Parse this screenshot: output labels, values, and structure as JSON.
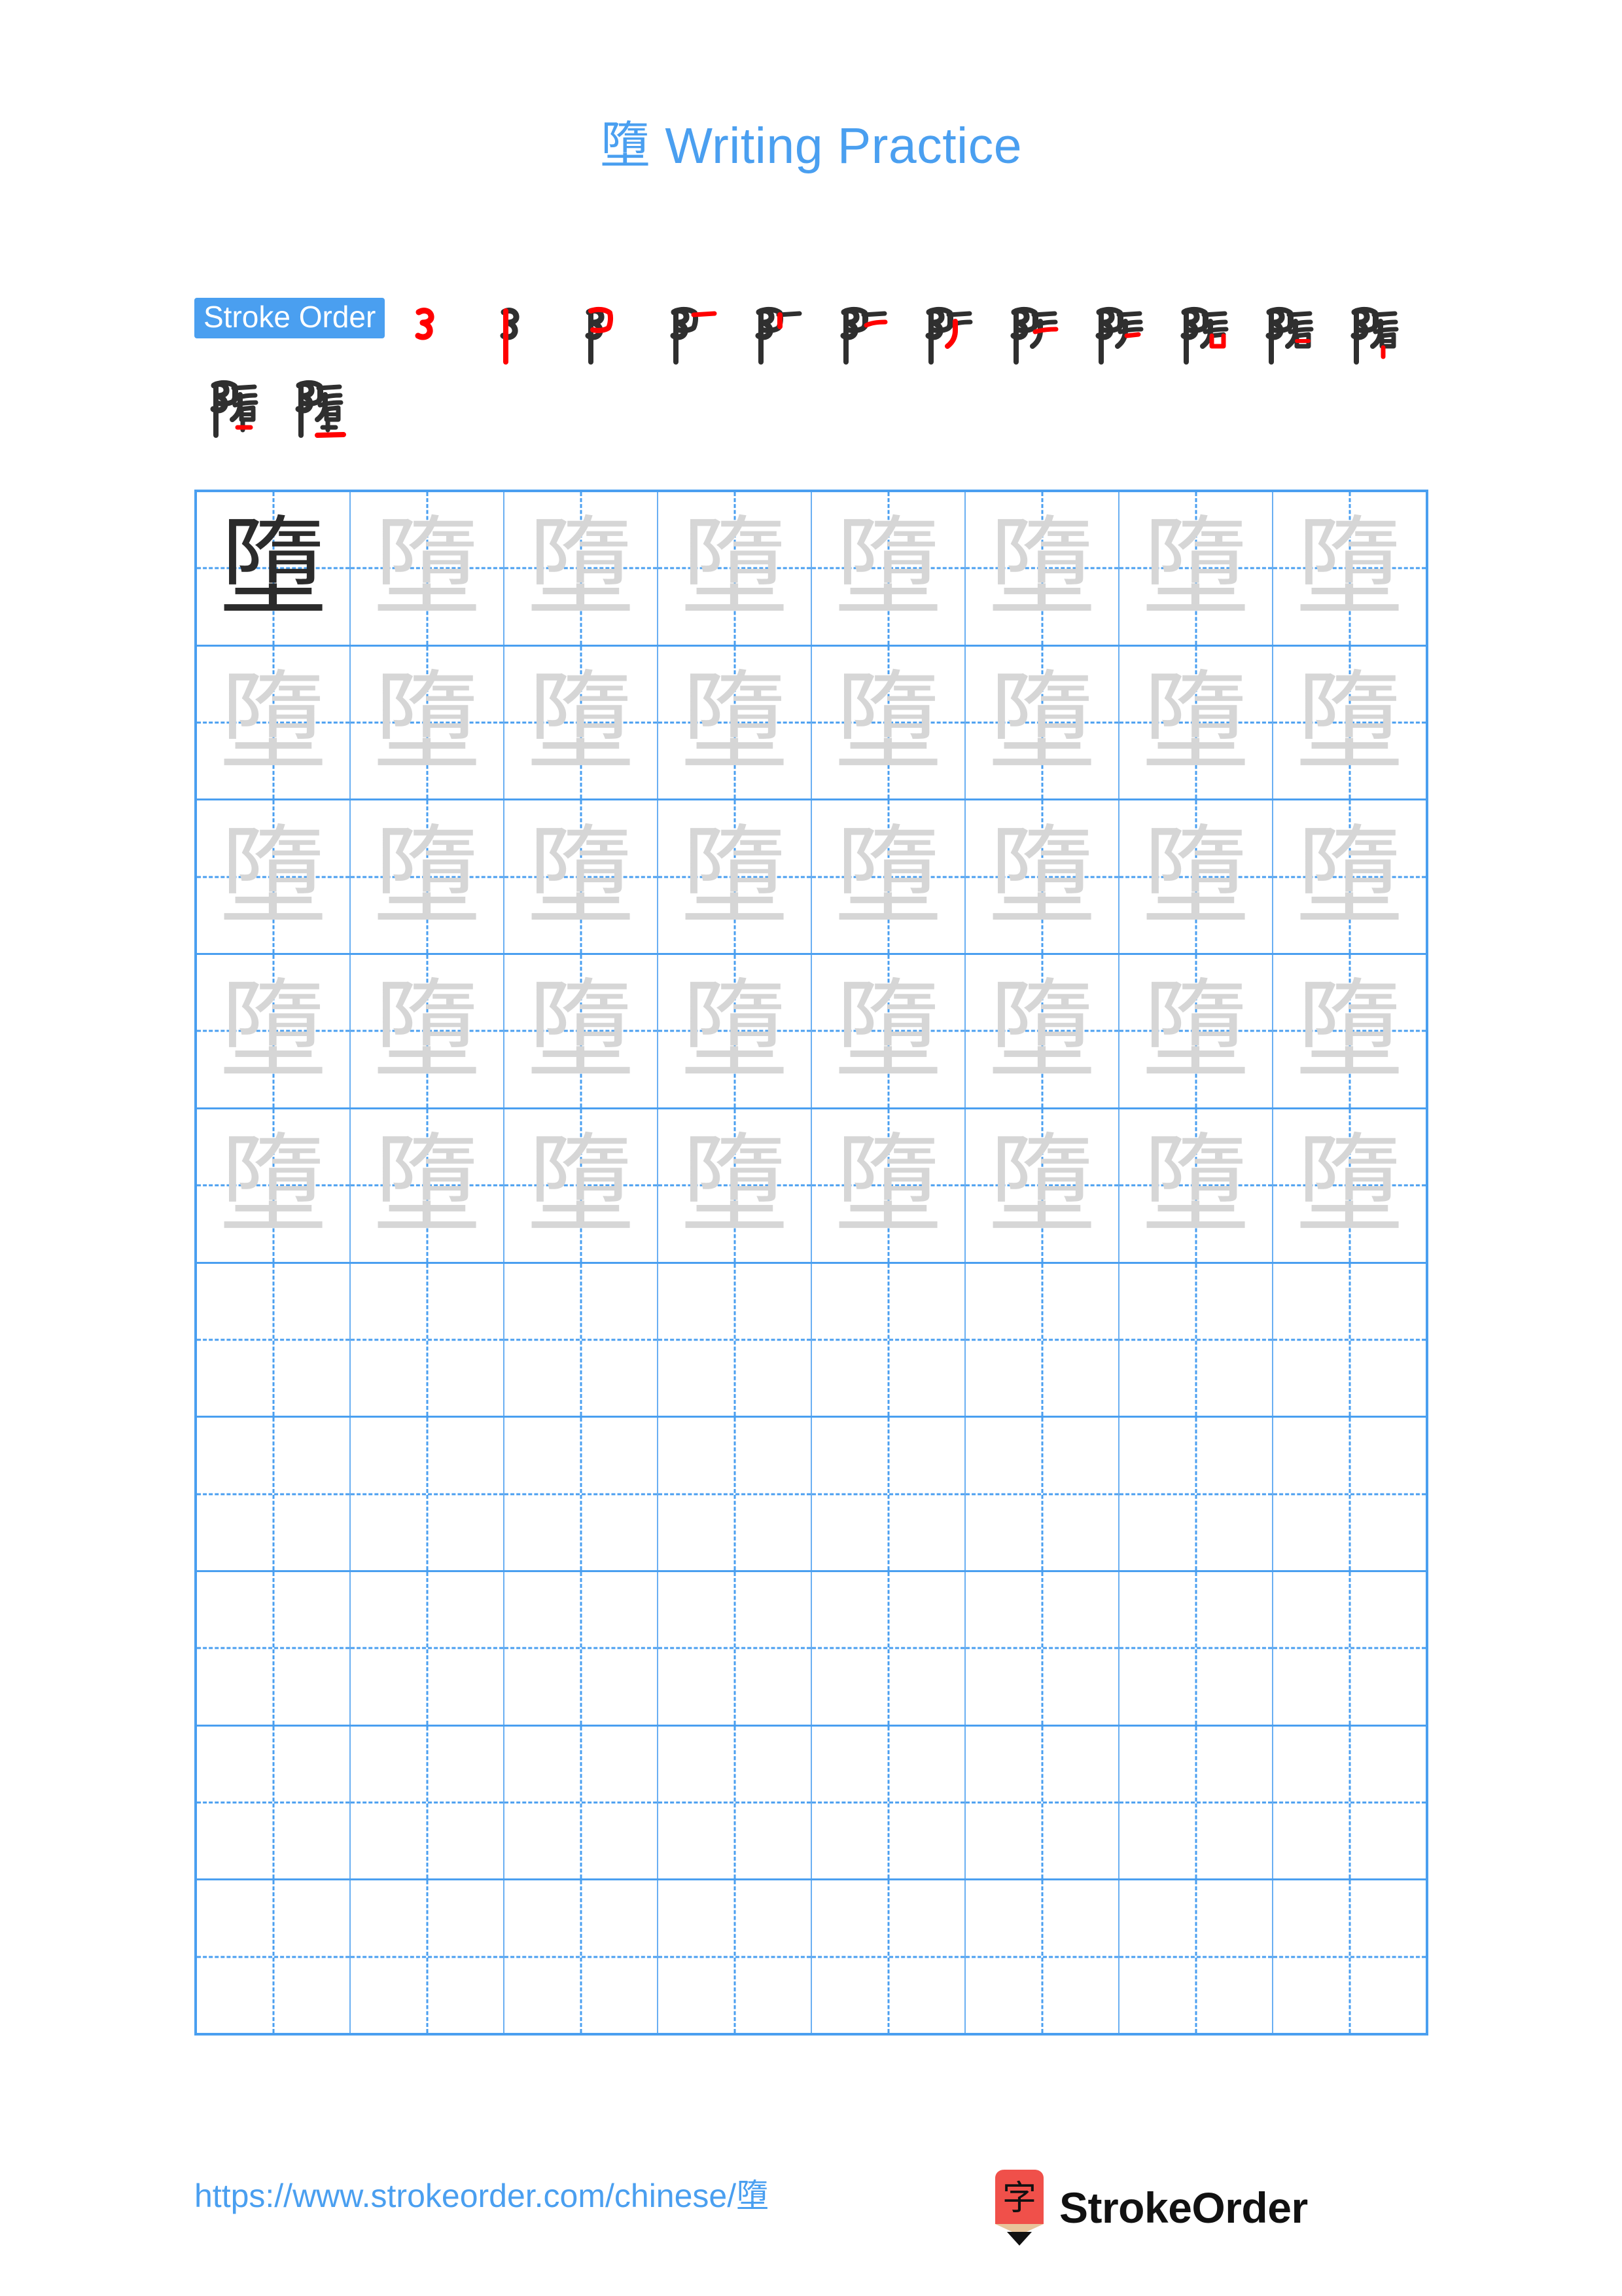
{
  "meta": {
    "character": "墮",
    "total_strokes": 14
  },
  "header": {
    "title_character": "墮",
    "title_text": " Writing Practice",
    "title_color": "#4a9ff0"
  },
  "stroke_order": {
    "label": "Stroke Order",
    "label_bg": "#4a9ff0",
    "label_color": "#ffffff",
    "new_stroke_color": "#ff0000",
    "prior_stroke_color": "#2f2f2f",
    "steps": [
      {
        "index": 1,
        "strokes_shown": 1
      },
      {
        "index": 2,
        "strokes_shown": 2
      },
      {
        "index": 3,
        "strokes_shown": 3
      },
      {
        "index": 4,
        "strokes_shown": 4
      },
      {
        "index": 5,
        "strokes_shown": 5
      },
      {
        "index": 6,
        "strokes_shown": 6
      },
      {
        "index": 7,
        "strokes_shown": 7
      },
      {
        "index": 8,
        "strokes_shown": 8
      },
      {
        "index": 9,
        "strokes_shown": 9
      },
      {
        "index": 10,
        "strokes_shown": 10
      },
      {
        "index": 11,
        "strokes_shown": 11
      },
      {
        "index": 12,
        "strokes_shown": 12
      },
      {
        "index": 13,
        "strokes_shown": 13
      },
      {
        "index": 14,
        "strokes_shown": 14
      }
    ]
  },
  "practice_grid": {
    "columns": 8,
    "rows": 10,
    "grid_line_color": "#4a9ff0",
    "guide_line_color": "#4a9ff0",
    "model_glyph_color": "#2b2b2b",
    "trace_glyph_color": "#d6d6d6",
    "rows_data": [
      {
        "row": 1,
        "cells": [
          "墮",
          "墮",
          "墮",
          "墮",
          "墮",
          "墮",
          "墮",
          "墮"
        ],
        "first_is_model": true
      },
      {
        "row": 2,
        "cells": [
          "墮",
          "墮",
          "墮",
          "墮",
          "墮",
          "墮",
          "墮",
          "墮"
        ],
        "first_is_model": false
      },
      {
        "row": 3,
        "cells": [
          "墮",
          "墮",
          "墮",
          "墮",
          "墮",
          "墮",
          "墮",
          "墮"
        ],
        "first_is_model": false
      },
      {
        "row": 4,
        "cells": [
          "墮",
          "墮",
          "墮",
          "墮",
          "墮",
          "墮",
          "墮",
          "墮"
        ],
        "first_is_model": false
      },
      {
        "row": 5,
        "cells": [
          "墮",
          "墮",
          "墮",
          "墮",
          "墮",
          "墮",
          "墮",
          "墮"
        ],
        "first_is_model": false
      },
      {
        "row": 6,
        "cells": [
          "",
          "",
          "",
          "",
          "",
          "",
          "",
          ""
        ],
        "first_is_model": false
      },
      {
        "row": 7,
        "cells": [
          "",
          "",
          "",
          "",
          "",
          "",
          "",
          ""
        ],
        "first_is_model": false
      },
      {
        "row": 8,
        "cells": [
          "",
          "",
          "",
          "",
          "",
          "",
          "",
          ""
        ],
        "first_is_model": false
      },
      {
        "row": 9,
        "cells": [
          "",
          "",
          "",
          "",
          "",
          "",
          "",
          ""
        ],
        "first_is_model": false
      },
      {
        "row": 10,
        "cells": [
          "",
          "",
          "",
          "",
          "",
          "",
          "",
          ""
        ],
        "first_is_model": false
      }
    ]
  },
  "footer": {
    "url_prefix": "https://www.strokeorder.com/chinese/",
    "url_character": "墮",
    "url_color": "#4a9ff0",
    "brand_name": "StrokeOrder",
    "logo_character": "字",
    "logo_body_color": "#f0504a",
    "logo_wood_color": "#e8c49a",
    "logo_tip_color": "#111111"
  }
}
